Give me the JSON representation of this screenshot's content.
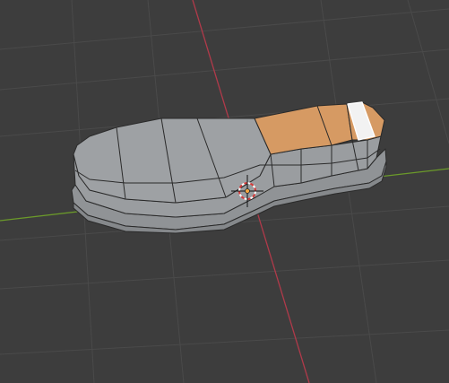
{
  "app": {
    "name": "3D viewport",
    "mode": "edit-mode-face-select"
  },
  "viewport": {
    "background_color": "#3d3d3d",
    "grid_color": "#4a4a4a",
    "x_axis_color": "#b03a4a",
    "y_axis_color": "#6b9a2a"
  },
  "mesh": {
    "object_name": "shoe-sole-mesh",
    "unselected_face_color": "#9ea1a4",
    "selected_face_color": "#d69a63",
    "active_face_color": "#f2f2f2",
    "edge_color": "#2a2a2a",
    "selected_face_count": 2,
    "active_face_count": 1
  },
  "cursor": {
    "icon": "3d-cursor-icon"
  }
}
